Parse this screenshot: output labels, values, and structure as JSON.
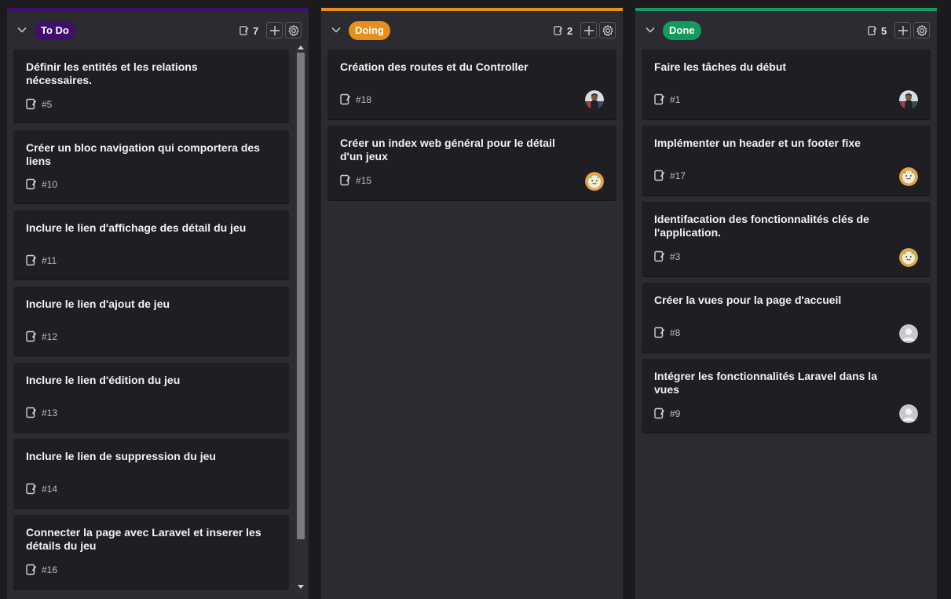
{
  "colors": {
    "todo": "#3f0f6b",
    "doing": "#e88f1b",
    "done": "#159a5e"
  },
  "columns": [
    {
      "name": "To Do",
      "count": "7",
      "cards": [
        {
          "title": "Définir les entités et les relations nécessaires.",
          "number": "#5"
        },
        {
          "title": "Créer un bloc navigation qui comportera des liens",
          "number": "#10"
        },
        {
          "title": "Inclure le lien d'affichage des détail du jeu",
          "number": "#11"
        },
        {
          "title": "Inclure le lien d'ajout de jeu",
          "number": "#12"
        },
        {
          "title": "Inclure le lien d'édition du jeu",
          "number": "#13"
        },
        {
          "title": "Inclure le lien de suppression du jeu",
          "number": "#14"
        },
        {
          "title": "Connecter la page avec Laravel et inserer les détails du jeu",
          "number": "#16"
        }
      ]
    },
    {
      "name": "Doing",
      "count": "2",
      "cards": [
        {
          "title": "Création des routes et du Controller",
          "number": "#18",
          "avatar": "photo"
        },
        {
          "title": "Créer un index web général pour le détail d'un jeux",
          "number": "#15",
          "avatar": "smiley"
        }
      ]
    },
    {
      "name": "Done",
      "count": "5",
      "cards": [
        {
          "title": "Faire les tâches du début",
          "number": "#1",
          "avatar": "photo"
        },
        {
          "title": "Implémenter un header et un footer fixe",
          "number": "#17",
          "avatar": "smiley"
        },
        {
          "title": "Identifacation des fonctionnalités clés de l'application.",
          "number": "#3",
          "avatar": "smiley"
        },
        {
          "title": "Créer la vues pour la page d'accueil",
          "number": "#8",
          "avatar": "default"
        },
        {
          "title": "Intégrer les fonctionnalités Laravel dans la vues",
          "number": "#9",
          "avatar": "default"
        }
      ]
    }
  ]
}
